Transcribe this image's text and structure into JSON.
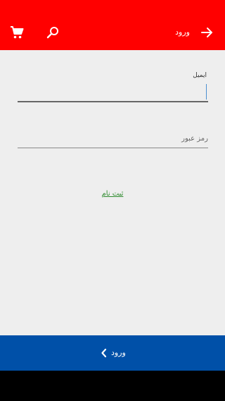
{
  "header": {
    "title": "ورود",
    "background": "#ff0000",
    "icons": {
      "cart": "shopping-cart-icon",
      "search": "search-icon",
      "back": "arrow-right-icon"
    }
  },
  "form": {
    "email_label": "ایمیل",
    "email_value": "",
    "password_placeholder": "رمز عبور",
    "password_value": "",
    "register_link": "ثبت نام"
  },
  "footer": {
    "login_label": "ورود",
    "background": "#0050a8",
    "icon": "chevron-left-icon"
  }
}
